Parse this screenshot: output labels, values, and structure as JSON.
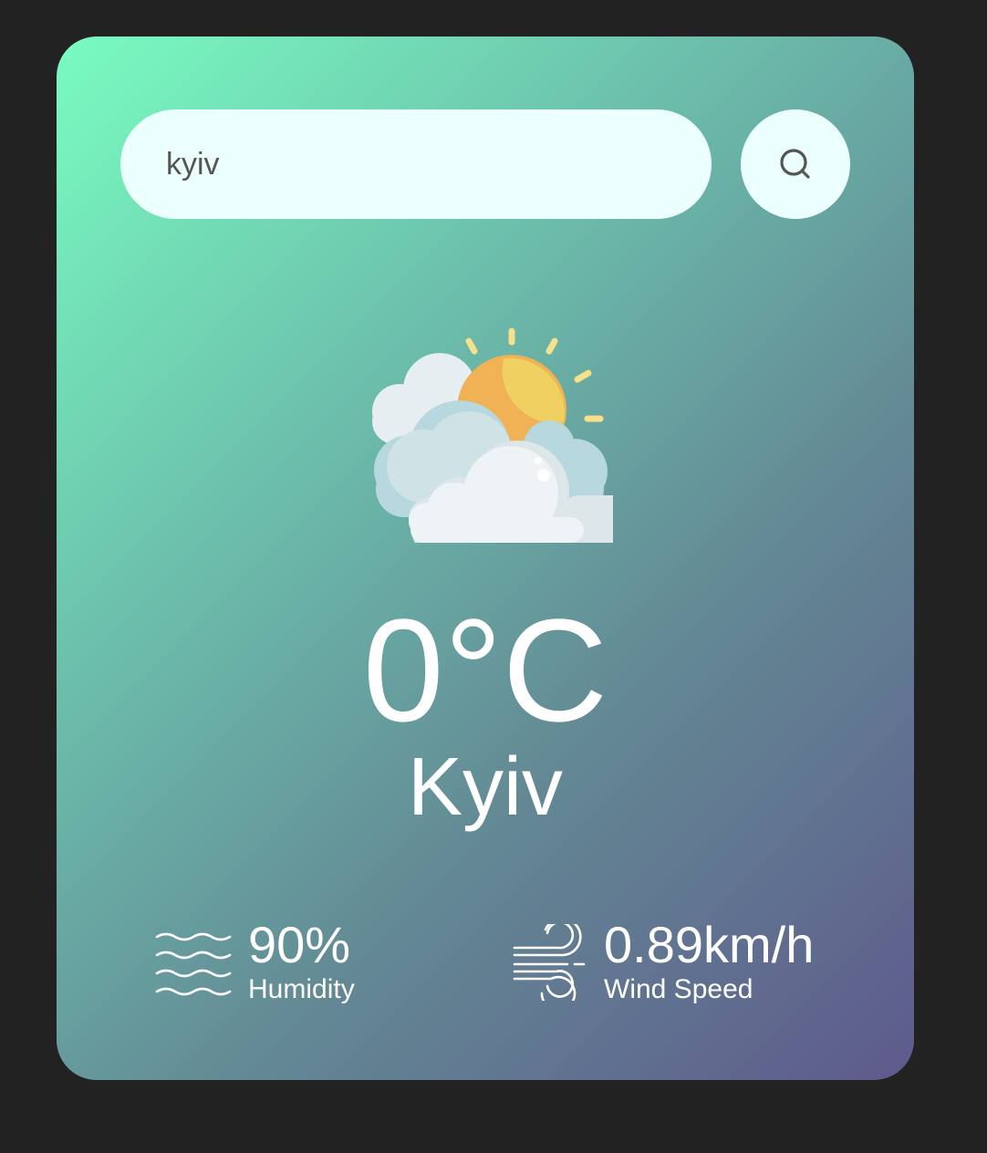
{
  "search": {
    "value": "kyiv",
    "button_icon": "search-icon"
  },
  "weather": {
    "icon": "partly-cloudy-icon",
    "temperature": "0°C",
    "city": "Kyiv"
  },
  "details": {
    "humidity": {
      "icon": "humidity-icon",
      "value": "90%",
      "label": "Humidity"
    },
    "wind": {
      "icon": "wind-icon",
      "value": "0.89km/h",
      "label": "Wind Speed"
    }
  },
  "colors": {
    "page_background": "#222222",
    "gradient_start": "#79fcc1",
    "gradient_end": "#5e5a8c",
    "input_background": "#ebfffc",
    "text": "#ffffff"
  }
}
